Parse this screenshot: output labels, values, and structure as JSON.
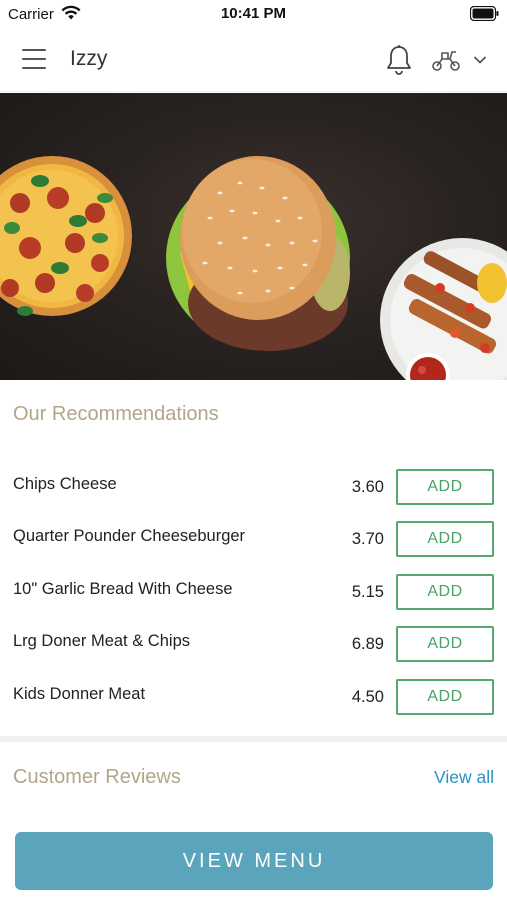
{
  "status_bar": {
    "carrier": "Carrier",
    "time": "10:41 PM"
  },
  "header": {
    "title": "Izzy",
    "icons": [
      "menu-icon",
      "bell-icon",
      "delivery-scooter-icon",
      "chevron-down-icon"
    ]
  },
  "hero": {
    "image_description_icons": [
      "pizza-image",
      "burger-image",
      "kebab-plate-image"
    ]
  },
  "recommendations": {
    "heading": "Our Recommendations",
    "items": [
      {
        "name": "Chips Cheese",
        "price": "3.60",
        "button": "ADD"
      },
      {
        "name": "Quarter Pounder Cheeseburger",
        "price": "3.70",
        "button": "ADD"
      },
      {
        "name": "10\" Garlic Bread With Cheese",
        "price": "5.15",
        "button": "ADD"
      },
      {
        "name": "Lrg Doner Meat & Chips",
        "price": "6.89",
        "button": "ADD"
      },
      {
        "name": "Kids Donner Meat",
        "price": "4.50",
        "button": "ADD"
      }
    ]
  },
  "reviews": {
    "heading": "Customer Reviews",
    "view_all": "View all"
  },
  "footer": {
    "view_menu": "VIEW MENU"
  },
  "colors": {
    "accent_gold": "#b3a588",
    "add_green": "#4aa266",
    "link_blue": "#2a93c4",
    "primary_button": "#5ba5bc"
  }
}
